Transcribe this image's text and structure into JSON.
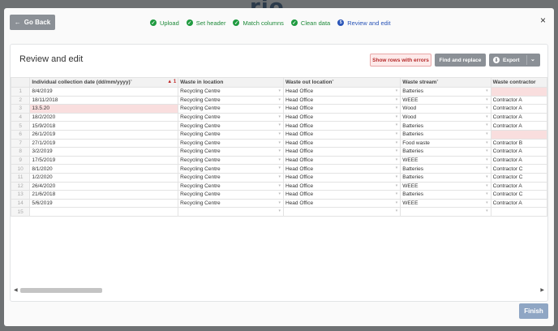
{
  "background_logo": "rio",
  "header": {
    "back_label": "Go Back",
    "steps": [
      {
        "label": "Upload",
        "state": "done"
      },
      {
        "label": "Set header",
        "state": "done"
      },
      {
        "label": "Match columns",
        "state": "done"
      },
      {
        "label": "Clean data",
        "state": "done"
      },
      {
        "label": "Review and edit",
        "state": "active",
        "number": "5"
      }
    ],
    "close_label": "×"
  },
  "card": {
    "title": "Review and edit",
    "show_errors_label": "Show rows with errors",
    "find_replace_label": "Find and replace",
    "export_label": "Export"
  },
  "table": {
    "columns": [
      "Individual collection date (dd/mm/yyyy)",
      "Waste in location",
      "Waste out location",
      "Waste stream",
      "Waste contractor"
    ],
    "required": [
      true,
      false,
      true,
      true,
      false
    ],
    "error_count": "1",
    "rows": [
      [
        "1",
        "8/4/2019",
        "Recycling Centre",
        "Head Office",
        "Batteries",
        ""
      ],
      [
        "2",
        "18/11/2018",
        "Recycling Centre",
        "Head Office",
        "WEEE",
        "Contractor A"
      ],
      [
        "3",
        "13.5.20",
        "Recycling Centre",
        "Head Office",
        "Wood",
        "Contractor A"
      ],
      [
        "4",
        "18/2/2020",
        "Recycling Centre",
        "Head Office",
        "Wood",
        "Contractor A"
      ],
      [
        "5",
        "15/9/2018",
        "Recycling Centre",
        "Head Office",
        "Batteries",
        "Contractor A"
      ],
      [
        "6",
        "26/1/2019",
        "Recycling Centre",
        "Head Office",
        "Batteries",
        ""
      ],
      [
        "7",
        "27/1/2019",
        "Recycling Centre",
        "Head Office",
        "Food waste",
        "Contractor B"
      ],
      [
        "8",
        "3/2/2019",
        "Recycling Centre",
        "Head Office",
        "Batteries",
        "Contractor A"
      ],
      [
        "9",
        "17/5/2019",
        "Recycling Centre",
        "Head Office",
        "WEEE",
        "Contractor A"
      ],
      [
        "10",
        "8/1/2020",
        "Recycling Centre",
        "Head Office",
        "Batteries",
        "Contractor C"
      ],
      [
        "11",
        "1/2/2020",
        "Recycling Centre",
        "Head Office",
        "Batteries",
        "Contractor C"
      ],
      [
        "12",
        "26/4/2020",
        "Recycling Centre",
        "Head Office",
        "WEEE",
        "Contractor A"
      ],
      [
        "13",
        "21/6/2018",
        "Recycling Centre",
        "Head Office",
        "Batteries",
        "Contractor C"
      ],
      [
        "14",
        "5/6/2019",
        "Recycling Centre",
        "Head Office",
        "WEEE",
        "Contractor A"
      ],
      [
        "15",
        "",
        "",
        "",
        "",
        ""
      ]
    ],
    "error_cells": [
      [
        0,
        5
      ],
      [
        2,
        1
      ],
      [
        5,
        5
      ]
    ]
  },
  "footer": {
    "finish_label": "Finish"
  },
  "colors": {
    "success": "#1f9a3f",
    "active": "#2a55b8",
    "error_bg": "#f9dede",
    "button_gray": "#8b9096",
    "finish_disabled": "#8fa6c4"
  }
}
